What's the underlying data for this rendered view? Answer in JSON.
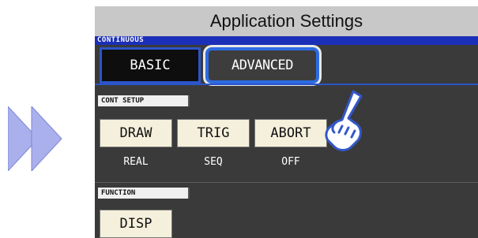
{
  "window": {
    "title": "Application Settings"
  },
  "mode_label": "CONTINUOUS",
  "tabs": [
    {
      "label": "BASIC",
      "selected": false
    },
    {
      "label": "ADVANCED",
      "selected": true
    }
  ],
  "cont_setup": {
    "heading": "CONT SETUP",
    "buttons": [
      {
        "label": "DRAW",
        "value": "REAL"
      },
      {
        "label": "TRIG",
        "value": "SEQ"
      },
      {
        "label": "ABORT",
        "value": "OFF"
      }
    ]
  },
  "function": {
    "heading": "FUNCTION",
    "buttons": [
      {
        "label": "DISP"
      }
    ]
  },
  "icons": {
    "arrows": "double-chevron-right-icon",
    "hand": "pointing-hand-icon"
  },
  "colors": {
    "screen_bg": "#3a3a3a",
    "mode_bar": "#1c2fb8",
    "tab_accent": "#2d6be3",
    "button_bg": "#f5f0dc",
    "arrow_fill": "#aab0ec"
  }
}
